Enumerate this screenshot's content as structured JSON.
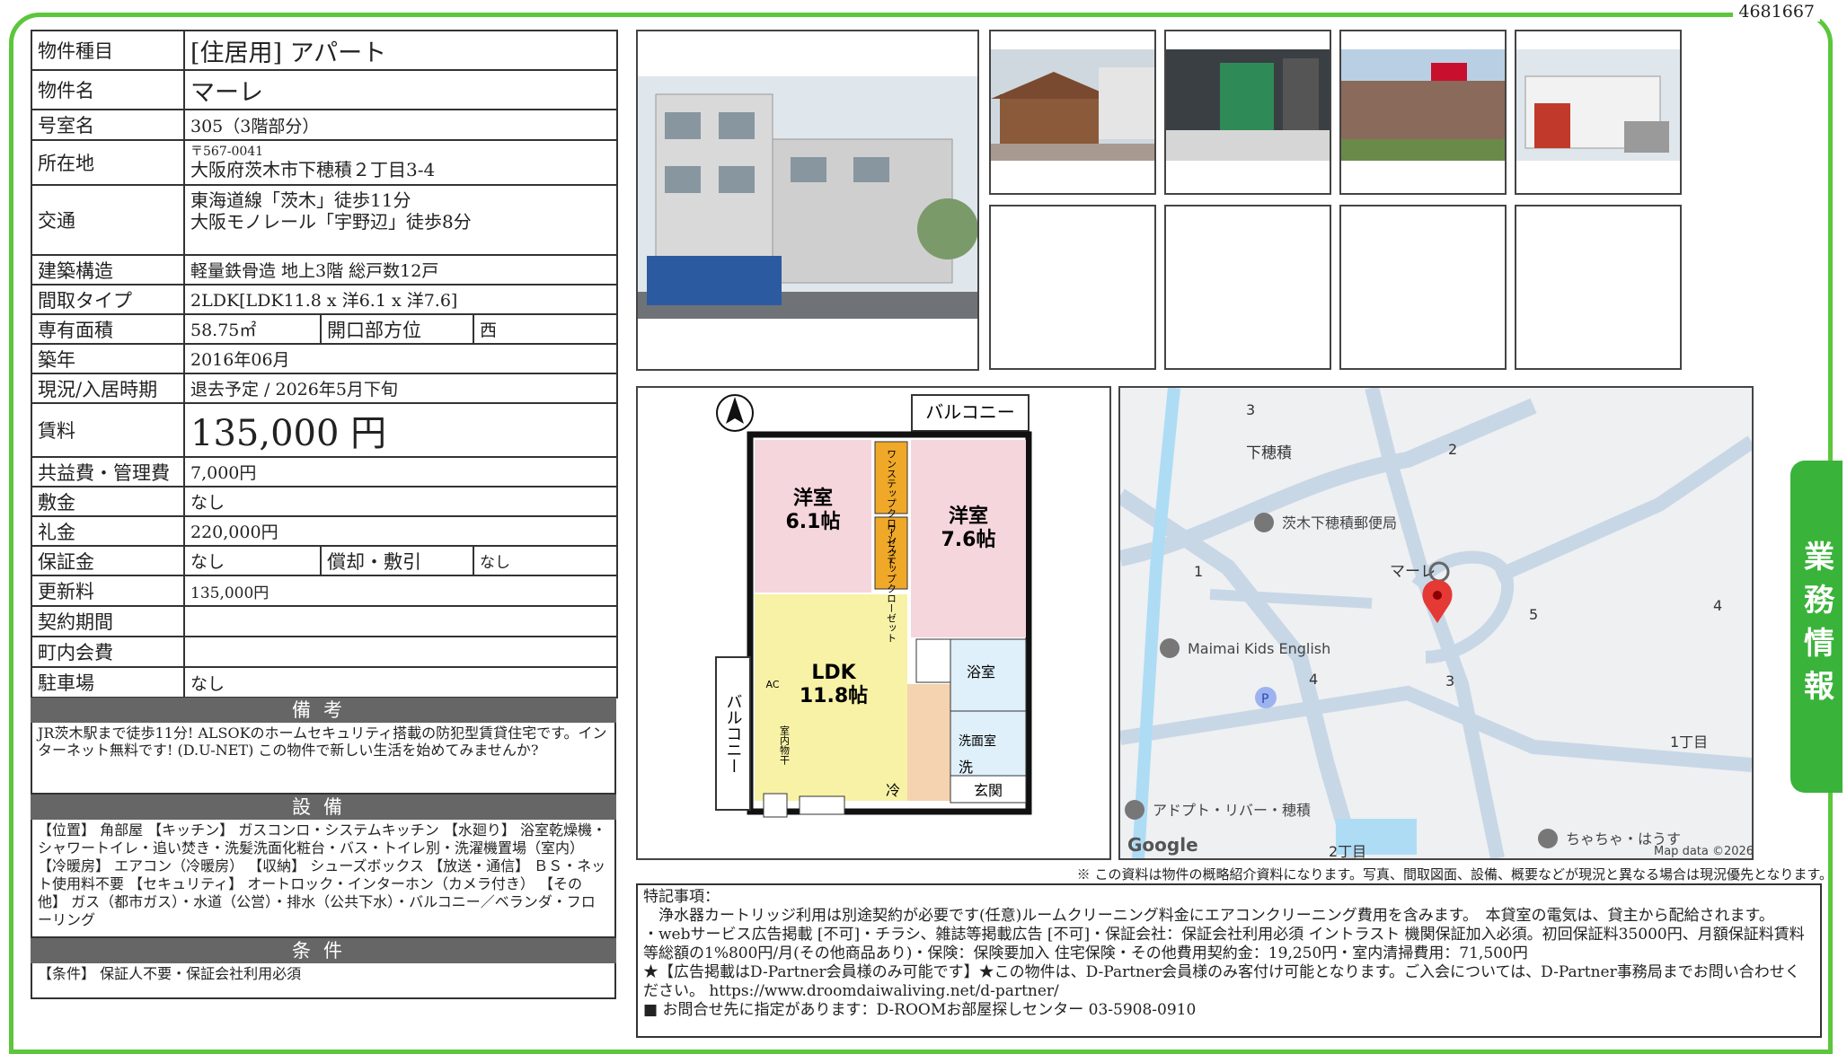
{
  "doc_id": "4681667",
  "side_tab": "業務情報",
  "info": {
    "type_label": "物件種目",
    "type_value": "[住居用] アパート",
    "name_label": "物件名",
    "name_value": "マーレ",
    "room_label": "号室名",
    "room_value": "305（3階部分）",
    "address_label": "所在地",
    "postal": "〒567-0041",
    "address": "大阪府茨木市下穂積２丁目3-4",
    "transport_label": "交通",
    "transport_1": "東海道線「茨木」徒歩11分",
    "transport_2": "大阪モノレール「宇野辺」徒歩8分",
    "structure_label": "建築構造",
    "structure_value": "軽量鉄骨造 地上3階 総戸数12戸",
    "layout_label": "間取タイプ",
    "layout_value": "2LDK[LDK11.8 x 洋6.1 x 洋7.6]",
    "area_label": "専有面積",
    "area_value": "58.75㎡",
    "facing_label": "開口部方位",
    "facing_value": "西",
    "built_label": "築年",
    "built_value": "2016年06月",
    "status_label": "現況/入居時期",
    "status_value": "退去予定 / 2026年5月下旬",
    "rent_label": "賃料",
    "rent_value": "135,000 円",
    "fee_label": "共益費・管理費",
    "fee_value": "7,000円",
    "deposit_label": "敷金",
    "deposit_value": "なし",
    "keymoney_label": "礼金",
    "keymoney_value": "220,000円",
    "guarantee_label": "保証金",
    "guarantee_value": "なし",
    "amort_label": "償却・敷引",
    "amort_value": "なし",
    "renewal_label": "更新料",
    "renewal_value": "135,000円",
    "contract_label": "契約期間",
    "contract_value": "",
    "town_label": "町内会費",
    "town_value": "",
    "parking_label": "駐車場",
    "parking_value": "なし"
  },
  "remarks": {
    "title": "備考",
    "text": "JR茨木駅まで徒歩11分! ALSOKのホームセキュリティ搭載の防犯型賃貸住宅です。インターネット無料です! (D.U-NET) この物件で新しい生活を始めてみませんか?"
  },
  "equipment": {
    "title": "設備",
    "text": "【位置】 角部屋 【キッチン】 ガスコンロ・システムキッチン 【水廻り】 浴室乾燥機・シャワートイレ・追い焚き・洗髪洗面化粧台・バス・トイレ別・洗濯機置場（室内） 【冷暖房】 エアコン（冷暖房） 【収納】 シューズボックス 【放送・通信】 ＢＳ・ネット使用料不要 【セキュリティ】 オートロック・インターホン（カメラ付き） 【その他】 ガス（都市ガス）・水道（公営）・排水（公共下水）・バルコニー／ベランダ・フローリング"
  },
  "conditions": {
    "title": "条件",
    "text": "【条件】 保証人不要・保証会社利用必須"
  },
  "floorplan": {
    "balcony_top": "バルコニー",
    "balcony_side": "バルコニー",
    "room1": "洋室",
    "room1_size": "6.1帖",
    "room2": "洋室",
    "room2_size": "7.6帖",
    "closet1": "ワンステップクローゼット",
    "closet2": "ワンステップクローゼット",
    "ldk": "LDK",
    "ldk_size": "11.8帖",
    "bath": "浴室",
    "washroom": "洗面室",
    "wash": "洗",
    "entrance": "玄関",
    "fridge": "冷",
    "ac": "AC",
    "indoor_dry": "室内物干"
  },
  "map": {
    "labels": [
      "下穂積",
      "茨木下穂積郵便局",
      "マーレ",
      "Maimai Kids English",
      "アドプト・リバー・穂積",
      "ちゃちゃ・はうす",
      "1丁目",
      "2丁目"
    ],
    "numbers": [
      "3",
      "2",
      "1",
      "5",
      "4",
      "4",
      "3"
    ],
    "google": "Google",
    "mapdata": "Map data ©2026",
    "pin_color": "#e53935"
  },
  "disclaimer": "※ この資料は物件の概略紹介資料になります。写真、間取図面、設備、概要などが現況と異なる場合は現況優先となります。",
  "notes": {
    "line1": "特記事項：",
    "line2": "　浄水器カートリッジ利用は別途契約が必要です(任意)ルームクリーニング料金にエアコンクリーニング費用を含みます。　本貸室の電気は、貸主から配給されます。",
    "line3": "・webサービス広告掲載 [不可]・チラシ、雑誌等掲載広告 [不可]・保証会社：保証会社利用必須 イントラスト 機関保証加入必須。初回保証料35000円、月額保証料賃料等総額の1%800円/月(その他商品あり)・保険：保険要加入 住宅保険・その他費用契約金：19,250円・室内清掃費用：71,500円",
    "line4": "★【広告掲載はD-Partner会員様のみ可能です】★この物件は、D-Partner会員様のみ客付け可能となります。ご入会については、D-Partner事務局までお問い合わせください。 https://www.droomdaiwaliving.net/d-partner/",
    "line5": "■ お問合せ先に指定があります：D-ROOMお部屋探しセンター 03-5908-0910"
  },
  "colors": {
    "accent": "#5cc63c",
    "tab": "#3ab33a",
    "section": "#666666"
  }
}
